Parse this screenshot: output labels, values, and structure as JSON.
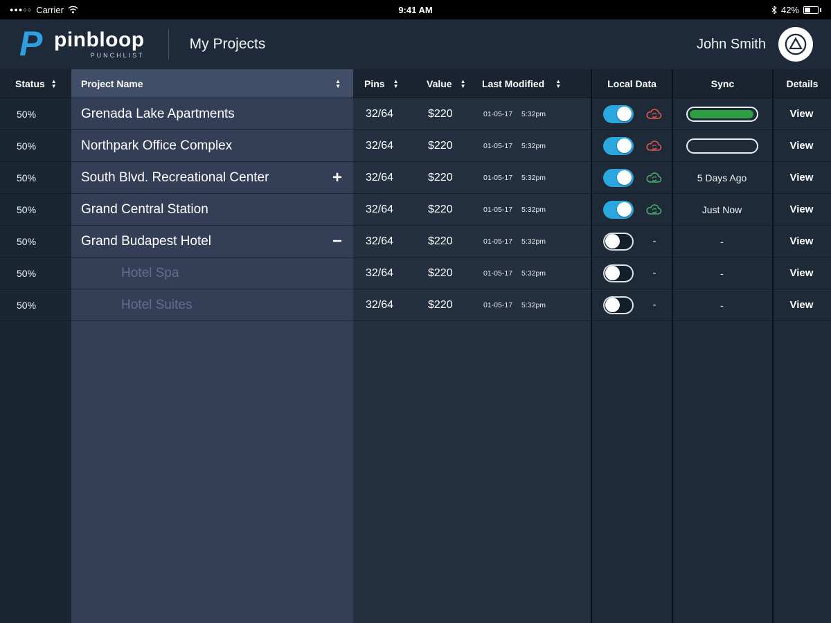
{
  "status_bar": {
    "signal": "●●●○○",
    "carrier": "Carrier",
    "time": "9:41 AM",
    "battery": "42%"
  },
  "header": {
    "brand_pin": "pin",
    "brand_bloop": "bloop",
    "brand_sub": "PUNCHLIST",
    "title": "My Projects",
    "user": "John Smith"
  },
  "table": {
    "dash": "-",
    "columns": {
      "status": "Status",
      "project": "Project Name",
      "pins": "Pins",
      "value": "Value",
      "modified": "Last Modified",
      "local": "Local Data",
      "sync": "Sync",
      "details": "Details"
    },
    "colors": {
      "toggle_on": "#2ba7e0",
      "sync_fill": "#2f9e42",
      "cloud_error": "#e0564f",
      "cloud_ok": "#4aa968"
    },
    "rows": [
      {
        "status": "50%",
        "name": "Grenada Lake Apartments",
        "indent": false,
        "expander": "",
        "pins": "32/64",
        "value": "$220",
        "modified_date": "01-05-17",
        "modified_time": "5:32pm",
        "toggle": true,
        "cloud": "red",
        "sync": {
          "kind": "bar",
          "fill": 92,
          "label": ""
        },
        "details": "View"
      },
      {
        "status": "50%",
        "name": "Northpark Office Complex",
        "indent": false,
        "expander": "",
        "pins": "32/64",
        "value": "$220",
        "modified_date": "01-05-17",
        "modified_time": "5:32pm",
        "toggle": true,
        "cloud": "red",
        "sync": {
          "kind": "bar",
          "fill": 0,
          "label": ""
        },
        "details": "View"
      },
      {
        "status": "50%",
        "name": "South Blvd. Recreational Center",
        "indent": false,
        "expander": "+",
        "pins": "32/64",
        "value": "$220",
        "modified_date": "01-05-17",
        "modified_time": "5:32pm",
        "toggle": true,
        "cloud": "green",
        "sync": {
          "kind": "text",
          "fill": 0,
          "label": "5 Days Ago"
        },
        "details": "View"
      },
      {
        "status": "50%",
        "name": "Grand Central Station",
        "indent": false,
        "expander": "",
        "pins": "32/64",
        "value": "$220",
        "modified_date": "01-05-17",
        "modified_time": "5:32pm",
        "toggle": true,
        "cloud": "green",
        "sync": {
          "kind": "text",
          "fill": 0,
          "label": "Just Now"
        },
        "details": "View"
      },
      {
        "status": "50%",
        "name": "Grand Budapest Hotel",
        "indent": false,
        "expander": "−",
        "pins": "32/64",
        "value": "$220",
        "modified_date": "01-05-17",
        "modified_time": "5:32pm",
        "toggle": false,
        "cloud": "none",
        "sync": {
          "kind": "text",
          "fill": 0,
          "label": "-"
        },
        "details": "View"
      },
      {
        "status": "50%",
        "name": "Hotel Spa",
        "indent": true,
        "expander": "",
        "pins": "32/64",
        "value": "$220",
        "modified_date": "01-05-17",
        "modified_time": "5:32pm",
        "toggle": false,
        "cloud": "none",
        "sync": {
          "kind": "text",
          "fill": 0,
          "label": "-"
        },
        "details": "View"
      },
      {
        "status": "50%",
        "name": "Hotel Suites",
        "indent": true,
        "expander": "",
        "pins": "32/64",
        "value": "$220",
        "modified_date": "01-05-17",
        "modified_time": "5:32pm",
        "toggle": false,
        "cloud": "none",
        "sync": {
          "kind": "text",
          "fill": 0,
          "label": "-"
        },
        "details": "View"
      }
    ]
  }
}
